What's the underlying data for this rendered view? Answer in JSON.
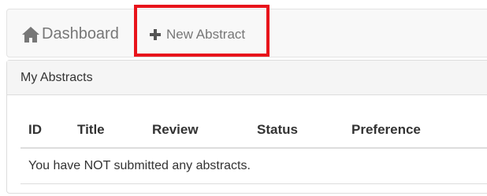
{
  "navbar": {
    "dashboard": {
      "label": "Dashboard",
      "icon": "home-icon"
    },
    "new_abstract": {
      "label": "New Abstract",
      "icon": "plus-icon"
    }
  },
  "highlight": {
    "color": "#e8141b"
  },
  "panel": {
    "heading": "My Abstracts",
    "table": {
      "columns": [
        "ID",
        "Title",
        "Review",
        "Status",
        "Preference"
      ],
      "empty_message": "You have NOT submitted any abstracts."
    }
  }
}
